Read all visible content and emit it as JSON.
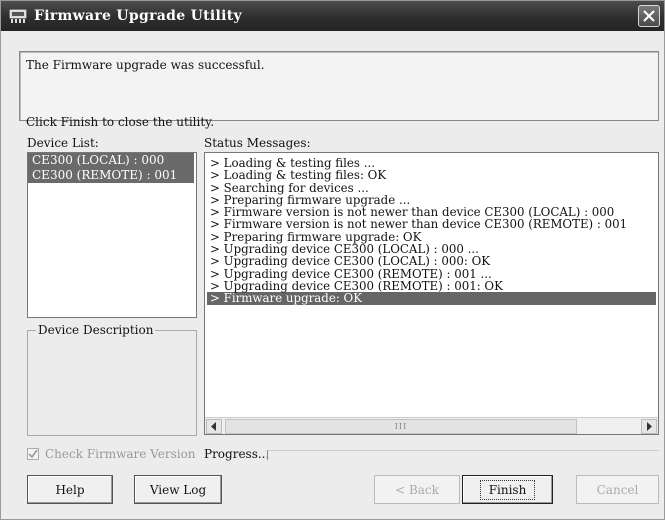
{
  "window": {
    "title": "Firmware Upgrade Utility",
    "icons": {
      "app": "chip-icon",
      "close": "close-icon"
    }
  },
  "message": {
    "line1": "The Firmware upgrade was successful.",
    "line2": "Click Finish to close the utility."
  },
  "device_list": {
    "label": "Device List:",
    "items": [
      "CE300 (LOCAL) : 000",
      "CE300 (REMOTE) : 001"
    ]
  },
  "status": {
    "label": "Status Messages:",
    "items": [
      "> Loading & testing files ...",
      "> Loading & testing files: OK",
      "> Searching for devices ...",
      "> Preparing firmware upgrade ...",
      "> Firmware version is not newer than device CE300 (LOCAL) : 000",
      "> Firmware version is not newer than device CE300 (REMOTE) : 001",
      "> Preparing firmware upgrade: OK",
      "> Upgrading device CE300 (LOCAL) : 000 ...",
      "> Upgrading device CE300 (LOCAL) : 000: OK",
      "> Upgrading device CE300 (REMOTE) : 001 ...",
      "> Upgrading device CE300 (REMOTE) : 001: OK",
      "> Firmware upgrade: OK"
    ],
    "selected_index": 11,
    "scroll_thumb_label": "III"
  },
  "device_description": {
    "label": "Device Description"
  },
  "check_firmware": {
    "label": "Check Firmware Version",
    "checked": true,
    "enabled": false
  },
  "progress": {
    "label": "Progress...",
    "value": 0
  },
  "buttons": {
    "help": "Help",
    "view_log": "View Log",
    "back": "< Back",
    "finish": "Finish",
    "cancel": "Cancel"
  },
  "colors": {
    "titlebar": "#2e2e2e",
    "selection": "#666666",
    "window_bg": "#ececec"
  }
}
